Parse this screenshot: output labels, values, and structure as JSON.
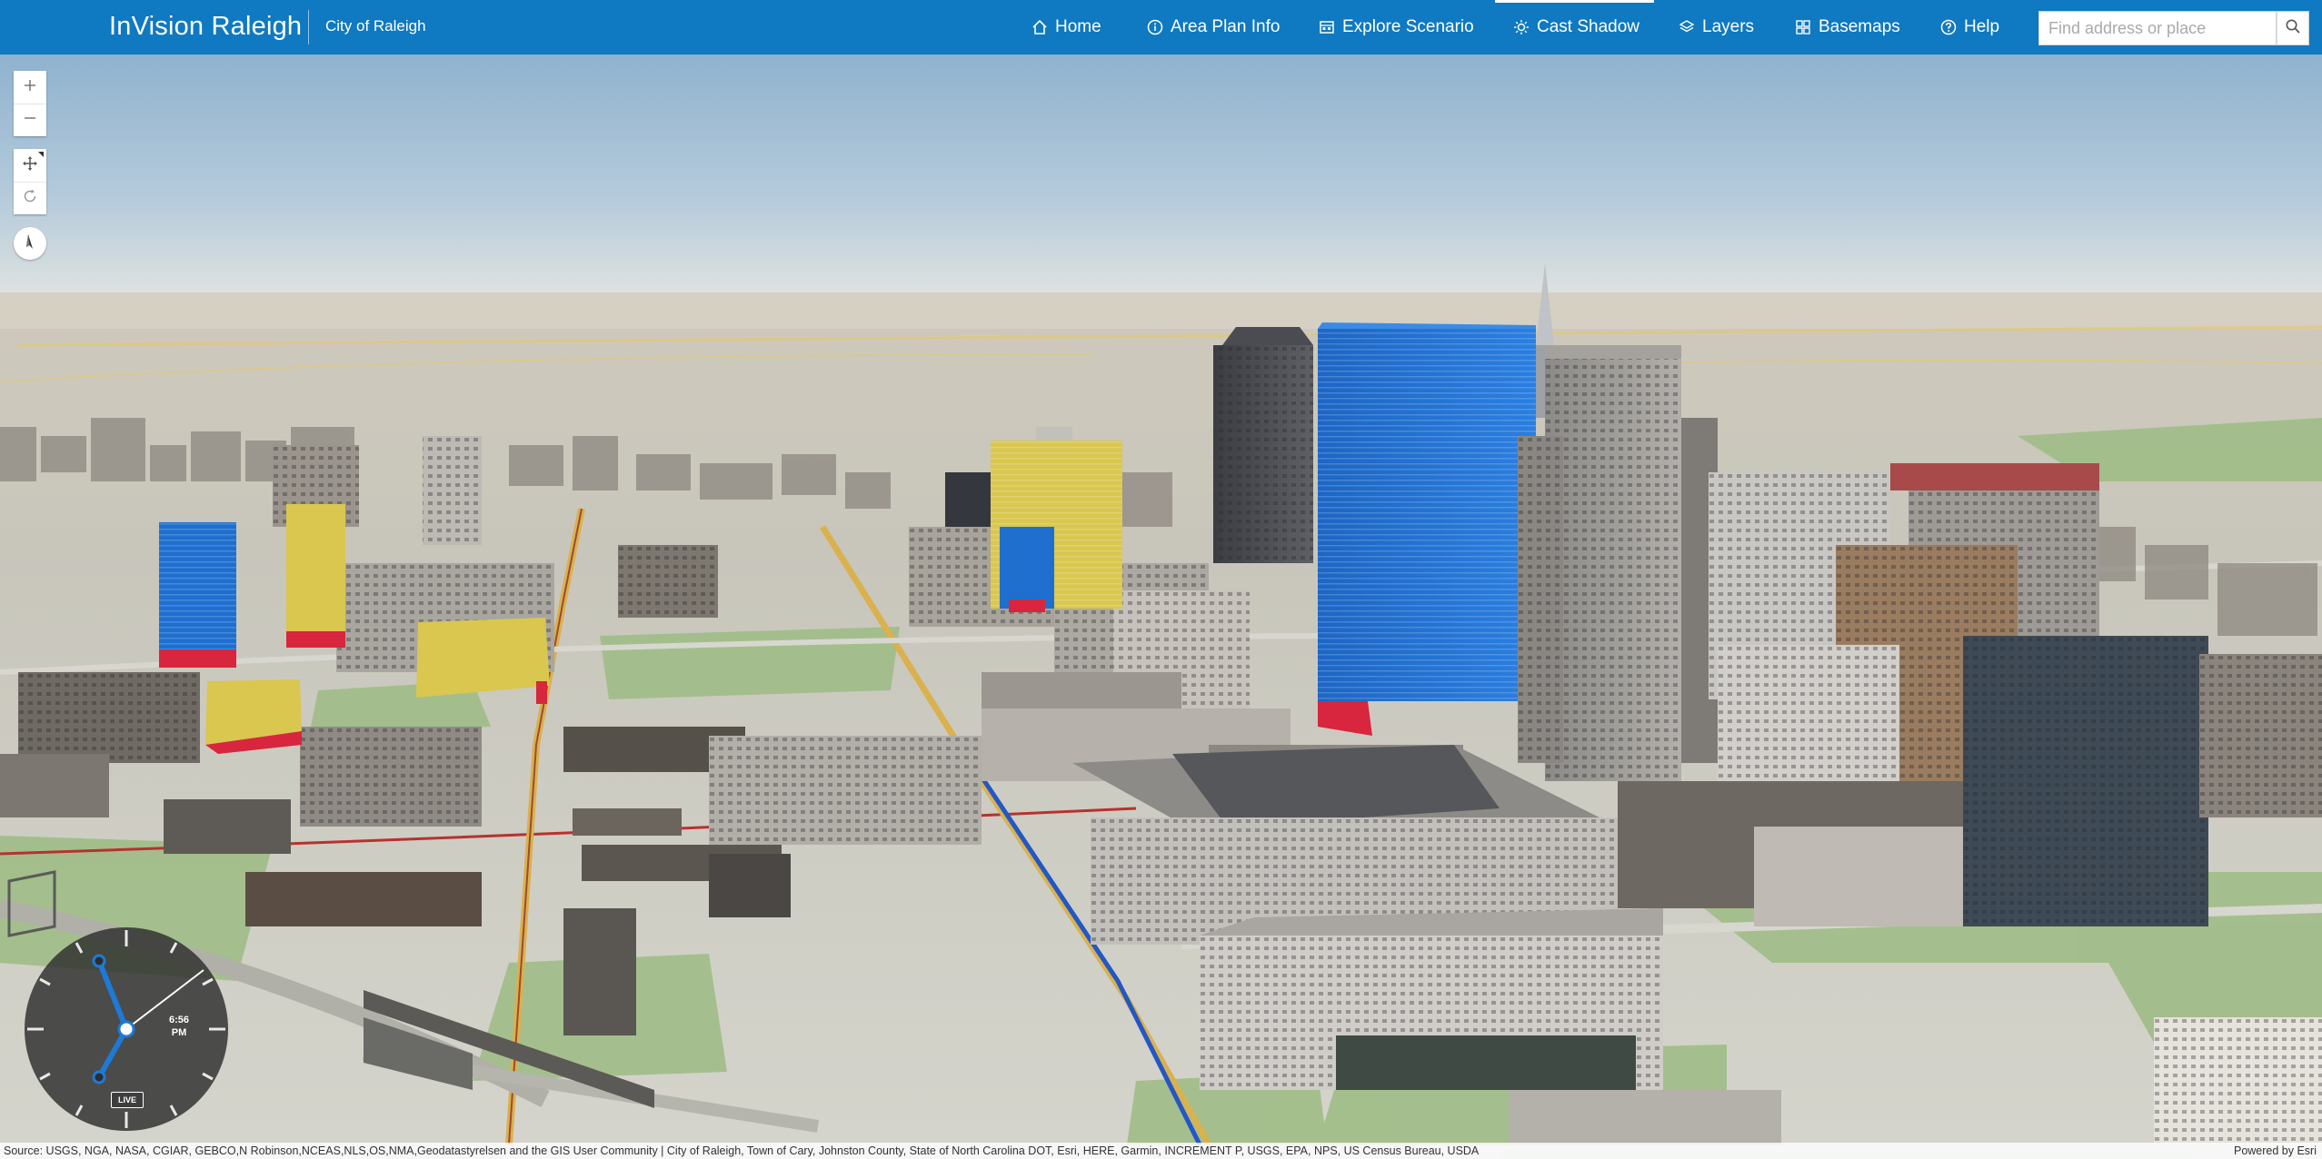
{
  "header": {
    "title": "InVision Raleigh",
    "subtitle": "City of Raleigh",
    "nav": [
      {
        "label": "Home",
        "icon": "home-icon"
      },
      {
        "label": "Area Plan Info",
        "icon": "info-icon"
      },
      {
        "label": "Explore Scenario",
        "icon": "scenario-icon"
      },
      {
        "label": "Cast Shadow",
        "icon": "sun-icon",
        "active": true
      },
      {
        "label": "Layers",
        "icon": "layers-icon"
      },
      {
        "label": "Basemaps",
        "icon": "basemaps-icon"
      },
      {
        "label": "Help",
        "icon": "help-icon"
      }
    ],
    "search": {
      "placeholder": "Find address or place",
      "value": ""
    }
  },
  "map_controls": {
    "zoom_in": "zoom-in-icon",
    "zoom_out": "zoom-out-icon",
    "pan": "pan-icon",
    "rotate": "rotate-icon",
    "compass": "compass-icon"
  },
  "shadow_clock": {
    "time": "6:56",
    "meridiem": "PM",
    "live_label": "LIVE"
  },
  "attribution": {
    "source": "Source: USGS, NGA, NASA, CGIAR, GEBCO,N Robinson,NCEAS,NLS,OS,NMA,Geodatastyrelsen and the GIS User Community | City of Raleigh, Town of Cary, Johnston County, State of North Carolina DOT, Esri, HERE, Garmin, INCREMENT P, USGS, EPA, NPS, US Census Bureau, USDA",
    "powered_by": "Powered by Esri"
  },
  "colors": {
    "header_bg": "#0f79c1",
    "scenario_blue": "#1f6fcf",
    "scenario_yellow": "#d9c74f",
    "scenario_red": "#d7263d"
  }
}
